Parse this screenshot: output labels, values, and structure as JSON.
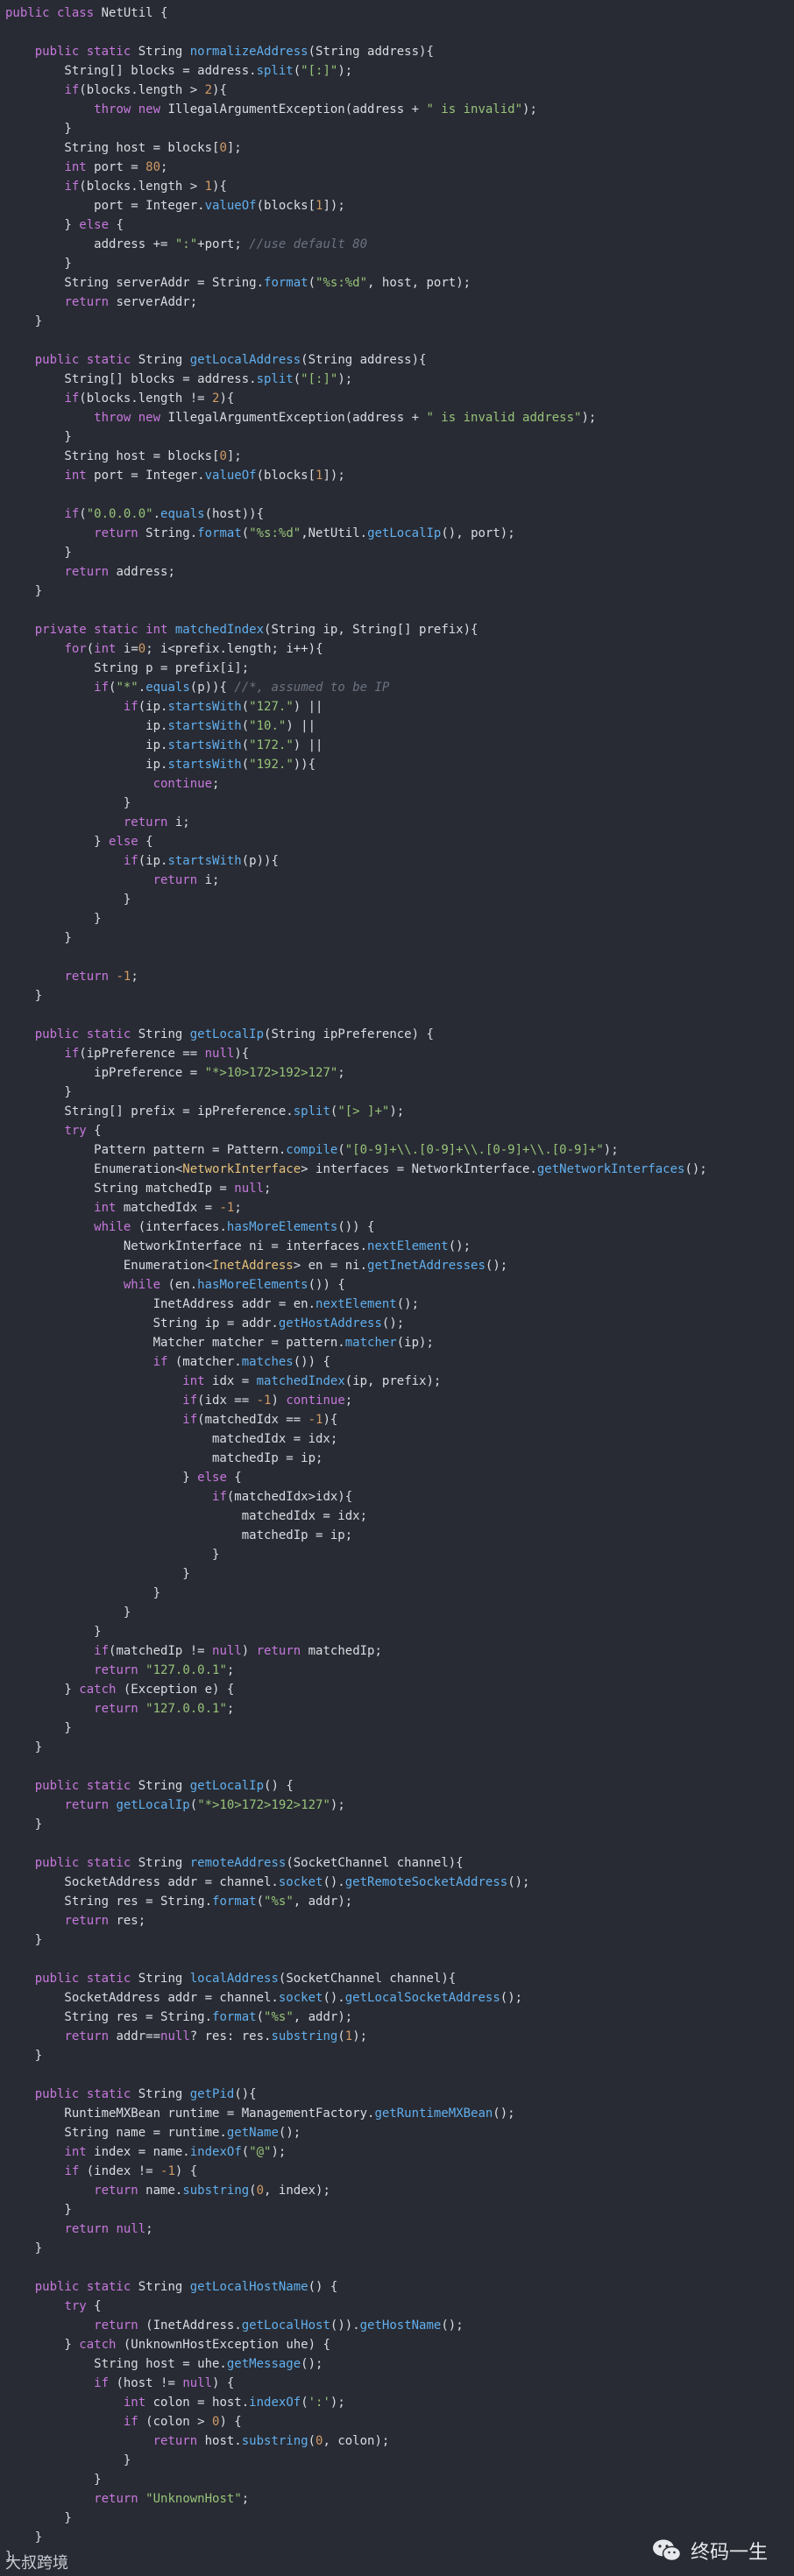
{
  "code": {
    "lines": [
      "<span class=kw>public class</span> NetUtil {",
      "",
      "    <span class=kw>public static</span> String <span class=fn>normalizeAddress</span>(String address){",
      "        String[] blocks = address.<span class=fn>split</span>(<span class=str>\"[:]\"</span>);",
      "        <span class=kw>if</span>(blocks.length &gt; <span class=num>2</span>){",
      "            <span class=kw>throw new</span> IllegalArgumentException(address + <span class=str>\" is invalid\"</span>);",
      "        }",
      "        String host = blocks[<span class=num>0</span>];",
      "        <span class=kw>int</span> port = <span class=num>80</span>;",
      "        <span class=kw>if</span>(blocks.length &gt; <span class=num>1</span>){",
      "            port = Integer.<span class=fn>valueOf</span>(blocks[<span class=num>1</span>]);",
      "        } <span class=kw>else</span> {",
      "            address += <span class=str>\":\"</span>+port; <span class=cm>//use default 80</span>",
      "        }",
      "        String serverAddr = String.<span class=fn>format</span>(<span class=str>\"%s:%d\"</span>, host, port);",
      "        <span class=kw>return</span> serverAddr;",
      "    }",
      "",
      "    <span class=kw>public static</span> String <span class=fn>getLocalAddress</span>(String address){",
      "        String[] blocks = address.<span class=fn>split</span>(<span class=str>\"[:]\"</span>);",
      "        <span class=kw>if</span>(blocks.length != <span class=num>2</span>){",
      "            <span class=kw>throw new</span> IllegalArgumentException(address + <span class=str>\" is invalid address\"</span>);",
      "        }",
      "        String host = blocks[<span class=num>0</span>];",
      "        <span class=kw>int</span> port = Integer.<span class=fn>valueOf</span>(blocks[<span class=num>1</span>]);",
      "",
      "        <span class=kw>if</span>(<span class=str>\"0.0.0.0\"</span>.<span class=fn>equals</span>(host)){",
      "            <span class=kw>return</span> String.<span class=fn>format</span>(<span class=str>\"%s:%d\"</span>,NetUtil.<span class=fn>getLocalIp</span>(), port);",
      "        }",
      "        <span class=kw>return</span> address;",
      "    }",
      "",
      "    <span class=kw>private static int</span> <span class=fn>matchedIndex</span>(String ip, String[] prefix){",
      "        <span class=kw>for</span>(<span class=kw>int</span> i=<span class=num>0</span>; i&lt;prefix.length; i++){",
      "            String p = prefix[i];",
      "            <span class=kw>if</span>(<span class=str>\"*\"</span>.<span class=fn>equals</span>(p)){ <span class=cm>//*, assumed to be IP</span>",
      "                <span class=kw>if</span>(ip.<span class=fn>startsWith</span>(<span class=str>\"127.\"</span>) ||",
      "                   ip.<span class=fn>startsWith</span>(<span class=str>\"10.\"</span>) ||",
      "                   ip.<span class=fn>startsWith</span>(<span class=str>\"172.\"</span>) ||",
      "                   ip.<span class=fn>startsWith</span>(<span class=str>\"192.\"</span>)){",
      "                    <span class=kw>continue</span>;",
      "                }",
      "                <span class=kw>return</span> i;",
      "            } <span class=kw>else</span> {",
      "                <span class=kw>if</span>(ip.<span class=fn>startsWith</span>(p)){",
      "                    <span class=kw>return</span> i;",
      "                }",
      "            }",
      "        }",
      "",
      "        <span class=kw>return</span> <span class=num>-1</span>;",
      "    }",
      "",
      "    <span class=kw>public static</span> String <span class=fn>getLocalIp</span>(String ipPreference) {",
      "        <span class=kw>if</span>(ipPreference == <span class=kw>null</span>){",
      "            ipPreference = <span class=str>\"*&gt;10&gt;172&gt;192&gt;127\"</span>;",
      "        }",
      "        String[] prefix = ipPreference.<span class=fn>split</span>(<span class=str>\"[&gt; ]+\"</span>);",
      "        <span class=kw>try</span> {",
      "            Pattern pattern = Pattern.<span class=fn>compile</span>(<span class=str>\"[0-9]+\\\\.[0-9]+\\\\.[0-9]+\\\\.[0-9]+\"</span>);",
      "            Enumeration&lt;<span class=typ>NetworkInterface</span>&gt; interfaces = NetworkInterface.<span class=fn>getNetworkInterfaces</span>();",
      "            String matchedIp = <span class=kw>null</span>;",
      "            <span class=kw>int</span> matchedIdx = <span class=num>-1</span>;",
      "            <span class=kw>while</span> (interfaces.<span class=fn>hasMoreElements</span>()) {",
      "                NetworkInterface ni = interfaces.<span class=fn>nextElement</span>();",
      "                Enumeration&lt;<span class=typ>InetAddress</span>&gt; en = ni.<span class=fn>getInetAddresses</span>();",
      "                <span class=kw>while</span> (en.<span class=fn>hasMoreElements</span>()) {",
      "                    InetAddress addr = en.<span class=fn>nextElement</span>();",
      "                    String ip = addr.<span class=fn>getHostAddress</span>();",
      "                    Matcher matcher = pattern.<span class=fn>matcher</span>(ip);",
      "                    <span class=kw>if</span> (matcher.<span class=fn>matches</span>()) {",
      "                        <span class=kw>int</span> idx = <span class=fn>matchedIndex</span>(ip, prefix);",
      "                        <span class=kw>if</span>(idx == <span class=num>-1</span>) <span class=kw>continue</span>;",
      "                        <span class=kw>if</span>(matchedIdx == <span class=num>-1</span>){",
      "                            matchedIdx = idx;",
      "                            matchedIp = ip;",
      "                        } <span class=kw>else</span> {",
      "                            <span class=kw>if</span>(matchedIdx&gt;idx){",
      "                                matchedIdx = idx;",
      "                                matchedIp = ip;",
      "                            }",
      "                        }",
      "                    }",
      "                }",
      "            }",
      "            <span class=kw>if</span>(matchedIp != <span class=kw>null</span>) <span class=kw>return</span> matchedIp;",
      "            <span class=kw>return</span> <span class=str>\"127.0.0.1\"</span>;",
      "        } <span class=kw>catch</span> (Exception e) {",
      "            <span class=kw>return</span> <span class=str>\"127.0.0.1\"</span>;",
      "        }",
      "    }",
      "",
      "    <span class=kw>public static</span> String <span class=fn>getLocalIp</span>() {",
      "        <span class=kw>return</span> <span class=fn>getLocalIp</span>(<span class=str>\"*&gt;10&gt;172&gt;192&gt;127\"</span>);",
      "    }",
      "",
      "    <span class=kw>public static</span> String <span class=fn>remoteAddress</span>(SocketChannel channel){",
      "        SocketAddress addr = channel.<span class=fn>socket</span>().<span class=fn>getRemoteSocketAddress</span>();",
      "        String res = String.<span class=fn>format</span>(<span class=str>\"%s\"</span>, addr);",
      "        <span class=kw>return</span> res;",
      "    }",
      "",
      "    <span class=kw>public static</span> String <span class=fn>localAddress</span>(SocketChannel channel){",
      "        SocketAddress addr = channel.<span class=fn>socket</span>().<span class=fn>getLocalSocketAddress</span>();",
      "        String res = String.<span class=fn>format</span>(<span class=str>\"%s\"</span>, addr);",
      "        <span class=kw>return</span> addr==<span class=kw>null</span>? res: res.<span class=fn>substring</span>(<span class=num>1</span>);",
      "    }",
      "",
      "    <span class=kw>public static</span> String <span class=fn>getPid</span>(){",
      "        RuntimeMXBean runtime = ManagementFactory.<span class=fn>getRuntimeMXBean</span>();",
      "        String name = runtime.<span class=fn>getName</span>();",
      "        <span class=kw>int</span> index = name.<span class=fn>indexOf</span>(<span class=str>\"@\"</span>);",
      "        <span class=kw>if</span> (index != <span class=num>-1</span>) {",
      "            <span class=kw>return</span> name.<span class=fn>substring</span>(<span class=num>0</span>, index);",
      "        }",
      "        <span class=kw>return</span> <span class=kw>null</span>;",
      "    }",
      "",
      "    <span class=kw>public static</span> String <span class=fn>getLocalHostName</span>() {",
      "        <span class=kw>try</span> {",
      "            <span class=kw>return</span> (InetAddress.<span class=fn>getLocalHost</span>()).<span class=fn>getHostName</span>();",
      "        } <span class=kw>catch</span> (UnknownHostException uhe) {",
      "            String host = uhe.<span class=fn>getMessage</span>();",
      "            <span class=kw>if</span> (host != <span class=kw>null</span>) {",
      "                <span class=kw>int</span> colon = host.<span class=fn>indexOf</span>(<span class=str>':'</span>);",
      "                <span class=kw>if</span> (colon &gt; <span class=num>0</span>) {",
      "                    <span class=kw>return</span> host.<span class=fn>substring</span>(<span class=num>0</span>, colon);",
      "                }",
      "            }",
      "            <span class=kw>return</span> <span class=str>\"UnknownHost\"</span>;",
      "        }",
      "    }",
      "}"
    ]
  },
  "watermark": {
    "left_text": "大叔跨境",
    "right_text": "终码一生",
    "icon": "wechat-icon"
  }
}
